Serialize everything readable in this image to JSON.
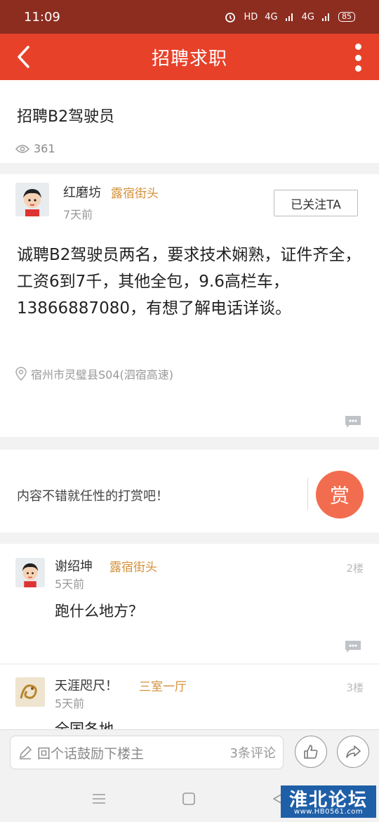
{
  "status_bar": {
    "time": "11:09",
    "network_1": "HD",
    "network_2": "4G",
    "network_3": "4G",
    "battery": "85"
  },
  "navbar": {
    "title": "招聘求职"
  },
  "post": {
    "title": "招聘B2驾驶员",
    "views": "361",
    "author": {
      "name": "红磨坊",
      "badge": "露宿街头",
      "time": "7天前"
    },
    "follow_label": "已关注TA",
    "content": "诚聘B2驾驶员两名，要求技术娴熟，证件齐全，工资6到7千，其他全包，9.6高栏车，13866887080，有想了解电话详谈。",
    "location": "宿州市灵璧县S04(泗宿高速)"
  },
  "tip": {
    "text": "内容不错就任性的打赏吧！",
    "reward_label": "赏"
  },
  "replies": [
    {
      "name": "谢绍坤",
      "badge": "露宿街头",
      "time": "5天前",
      "floor": "2楼",
      "text": "跑什么地方？"
    },
    {
      "name": "天涯咫尺！",
      "badge": "三室一厅",
      "time": "5天前",
      "floor": "3楼",
      "text": "全国各地"
    }
  ],
  "bottom_bar": {
    "placeholder": "回个话鼓励下楼主",
    "comment_count": "3条评论"
  },
  "watermark": {
    "title": "淮北论坛",
    "url": "www.HB0561.com"
  },
  "colors": {
    "header": "#e8412a",
    "status": "#8c2d20",
    "badge": "#d4913a",
    "reward": "#f26d4f"
  }
}
